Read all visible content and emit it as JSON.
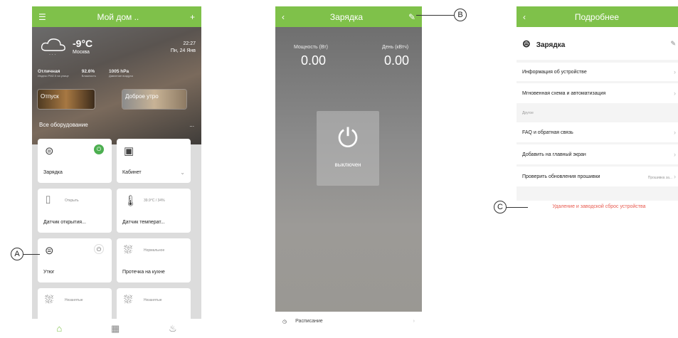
{
  "phone1": {
    "header_title": "Мой дом ..",
    "weather": {
      "temp": "-9°C",
      "city": "Москва",
      "time": "22:27",
      "date": "Пн, 24 Янв"
    },
    "stats": [
      {
        "value": "Отличная",
        "label": "Индекс PM2.5 на улице"
      },
      {
        "value": "92.6%",
        "label": "Влажность"
      },
      {
        "value": "1005 hPa",
        "label": "Давление воздуха"
      }
    ],
    "scenes": [
      "Отпуск",
      "Доброе утро"
    ],
    "all_devices": "Все оборудование",
    "more": "...",
    "devices": [
      {
        "name": "Зарядка",
        "status": ""
      },
      {
        "name": "Кабинет",
        "status": ""
      },
      {
        "name": "Датчик открытия...",
        "status": "Открыть"
      },
      {
        "name": "Датчик температ...",
        "status": "39.9°C / 34%"
      },
      {
        "name": "Утюг",
        "status": ""
      },
      {
        "name": "Протечка на кухне",
        "status": "Нормальное"
      },
      {
        "name": "",
        "status": "Незанятые"
      },
      {
        "name": "",
        "status": "Незанятые"
      }
    ]
  },
  "phone2": {
    "title": "Зарядка",
    "power_label": "Мощность (Вт)",
    "power_value": "0.00",
    "day_label": "День (кВтч)",
    "day_value": "0.00",
    "state": "выключен",
    "schedule": "Расписание"
  },
  "phone3": {
    "title": "Подробнее",
    "device_name": "Зарядка",
    "rows": [
      "Информация об устройстве",
      "Мгновенная схема и автоматизация"
    ],
    "section_other": "Другое",
    "rows2": [
      "FAQ и обратная связь",
      "Добавить на главный экран",
      "Проверить обновления прошивки"
    ],
    "firmware_hint": "Прошивка за...",
    "reset": "Удаление и заводской сброс устройства"
  },
  "callouts": {
    "a": "A",
    "b": "B",
    "c": "C"
  },
  "colors": {
    "accent": "#7fc14a",
    "danger": "#e85a4f"
  }
}
